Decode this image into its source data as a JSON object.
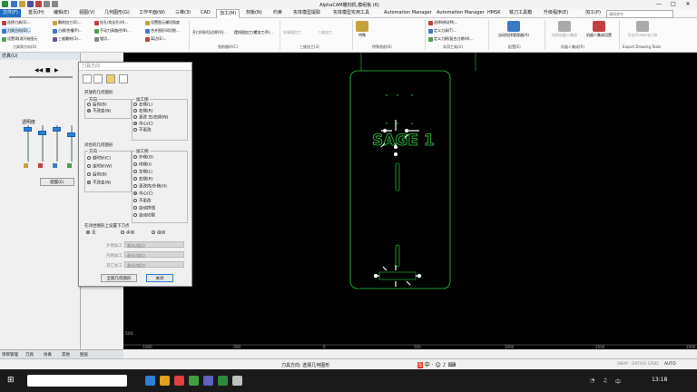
{
  "window": {
    "title": "AlphaCAM雕刻机,模组板 (6)",
    "min": "—",
    "max": "□",
    "close": "✕"
  },
  "tabs": [
    "文件(F)",
    "首页(H)",
    "编辑(E)",
    "视图(V)",
    "几何图形(G)",
    "工作平面(W)",
    "三维(3)",
    "CAD",
    "加工(M)",
    "刻板(N)",
    "约束",
    "实体模型提取",
    "实体模型实用工具",
    "Automation Manager",
    "Automation Manager",
    "HMSK",
    "铣刀工具箱",
    "升级程序(E)",
    "加工(P)"
  ],
  "search_placeholder": "请找命令",
  "ribbon": {
    "col1": [
      "选择刀具(S)...",
      "刀具方向(D)...",
      "设置/取消开始图元"
    ],
    "col2": [
      "雕刻加工(E)...",
      "凸模/挖槽(P)...",
      "三维雕刻(3)..."
    ],
    "col3": [
      "钻孔/攻丝孔(H)...",
      "手动刀具路径(N)...",
      "锯切..."
    ],
    "col4": [
      "设置图元辅切角度",
      "合并图形间切割...",
      "离边(E)..."
    ],
    "groups": [
      "刀具和方向(O)",
      "铣削循环(C)",
      "三维加工(3)",
      "特殊铣削(K)",
      "实用工具(U)",
      "配置(E)",
      "机器人集成(R)",
      "Export Drawing Tools"
    ],
    "g2": [
      "开口凹形切边界(O)...",
      "摆线粗加工/螺加工(R)..."
    ],
    "g3": [
      "轮廓粗加工",
      "三维加工"
    ],
    "g4": [
      "特殊"
    ],
    "g5": [
      "选择材料(M)...",
      "定义刀具(T)...",
      "定义刀柄/复合刀柄(H)..."
    ],
    "big_buttons": [
      "自动钻排管理器(A)",
      "钻削机器人集成",
      "机器人集成设置",
      "导出Drawing刀具"
    ]
  },
  "left_panel": {
    "title": "仿真(U)",
    "label_depth": "透明度",
    "apply_btn": "配置(E)"
  },
  "dialog": {
    "title": "刀具方向",
    "open_section": "开放的几何图形",
    "open_dir_label": "方向",
    "open_dir_options": [
      "后向(B)",
      "不改变(N)"
    ],
    "open_dir_selected": 1,
    "open_side_label": "加工侧",
    "open_side_options": [
      "左侧(L)",
      "右侧(R)",
      "更改 左/右侧(N)",
      "中心(C)",
      "不更改"
    ],
    "open_side_selected": 3,
    "closed_section": "闭合的几何图形",
    "closed_dir_label": "方向",
    "closed_dir_options": [
      "顺时针(C)",
      "逆时针(W)",
      "后向(B)",
      "不改变(N)"
    ],
    "closed_dir_selected": 3,
    "closed_side_label": "加工侧",
    "closed_side_options": [
      "外侧(O)",
      "内侧(I)",
      "左侧(L)",
      "右侧(R)",
      "更改内/外侧(H)",
      "中心(C)",
      "不更改",
      "自动挤线",
      "自动切割"
    ],
    "closed_side_selected": 5,
    "start_section": "在闭合图形上设置下刀点",
    "start_options": [
      "无",
      "手动",
      "自动"
    ],
    "start_selected": 0,
    "disabled_rows": [
      {
        "label": "外侧加工",
        "value": "最长边起点"
      },
      {
        "label": "内侧加工",
        "value": "最长边起点"
      },
      {
        "label": "其它加工",
        "value": "最长边起点"
      }
    ],
    "btn_all": "全部几何图形",
    "btn_close": "关闭"
  },
  "canvas": {
    "axis_labels": [
      "-1000",
      "-500",
      "0",
      "500",
      "1000",
      "1500",
      "2000"
    ],
    "y_label": "500",
    "text_mark": "SAGE 1"
  },
  "bottom_tabs": [
    "项目管理",
    "刀具",
    "仿真",
    "其他",
    "图层"
  ],
  "status": {
    "message": "刀具方向: 选择几何图形",
    "items": [
      "SNAP",
      "ORTHO",
      "GRID",
      "AUTO"
    ],
    "auto_label": "AUTO"
  },
  "taskbar": {
    "time": "13:18"
  },
  "colors": {
    "accent": "#1e6fc4",
    "canvas_bg": "#000000",
    "geometry": "#2ecc40",
    "taskbar": "#1a1a1a"
  }
}
